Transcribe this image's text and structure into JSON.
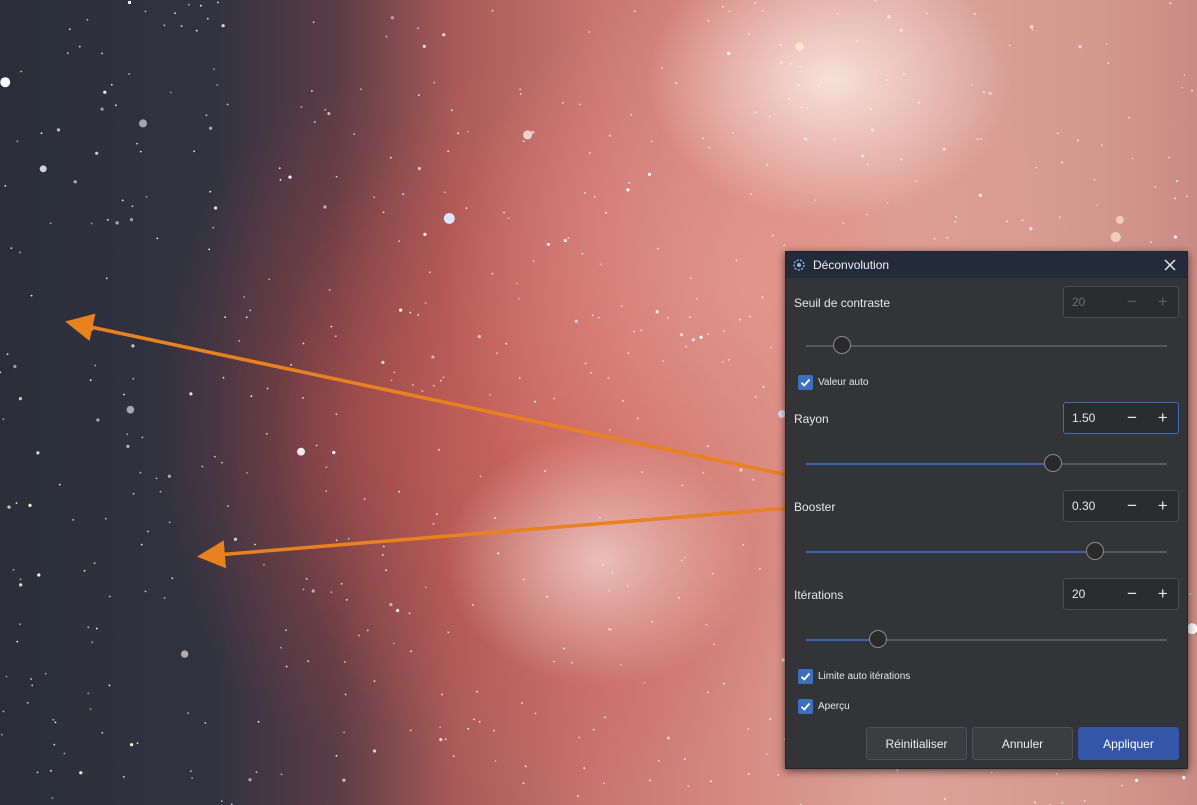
{
  "dialog": {
    "title": "Déconvolution",
    "contrast": {
      "label": "Seuil de contraste",
      "value": "20",
      "enabled": false,
      "slider_fraction": 0.1
    },
    "auto_value": {
      "label": "Valeur auto",
      "checked": true
    },
    "radius": {
      "label": "Rayon",
      "value": "1.50",
      "slider_fraction": 0.685
    },
    "booster": {
      "label": "Booster",
      "value": "0.30",
      "slider_fraction": 0.8
    },
    "iterations": {
      "label": "Itérations",
      "value": "20",
      "slider_fraction": 0.2
    },
    "auto_iter_limit": {
      "label": "Limite auto itérations",
      "checked": true
    },
    "preview": {
      "label": "Aperçu",
      "checked": true
    },
    "buttons": {
      "reset": "Réinitialiser",
      "cancel": "Annuler",
      "apply": "Appliquer"
    }
  },
  "colors": {
    "accent": "#3a63b5",
    "apply_button": "#3456a8",
    "arrow": "#e8821e",
    "dialog_bg": "#333437",
    "titlebar_bg": "#232b3a"
  },
  "icons": [
    "deconvolution-app-icon",
    "close-icon",
    "minus-icon",
    "plus-icon",
    "checkmark-icon"
  ]
}
